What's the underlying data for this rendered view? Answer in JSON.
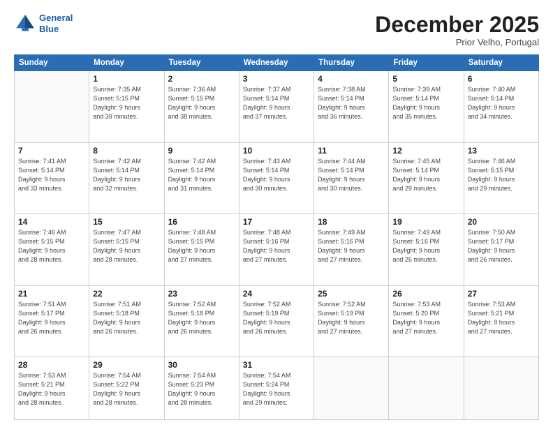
{
  "logo": {
    "line1": "General",
    "line2": "Blue"
  },
  "header": {
    "month": "December 2025",
    "location": "Prior Velho, Portugal"
  },
  "days_of_week": [
    "Sunday",
    "Monday",
    "Tuesday",
    "Wednesday",
    "Thursday",
    "Friday",
    "Saturday"
  ],
  "weeks": [
    [
      {
        "day": "",
        "info": ""
      },
      {
        "day": "1",
        "info": "Sunrise: 7:35 AM\nSunset: 5:15 PM\nDaylight: 9 hours\nand 39 minutes."
      },
      {
        "day": "2",
        "info": "Sunrise: 7:36 AM\nSunset: 5:15 PM\nDaylight: 9 hours\nand 38 minutes."
      },
      {
        "day": "3",
        "info": "Sunrise: 7:37 AM\nSunset: 5:14 PM\nDaylight: 9 hours\nand 37 minutes."
      },
      {
        "day": "4",
        "info": "Sunrise: 7:38 AM\nSunset: 5:14 PM\nDaylight: 9 hours\nand 36 minutes."
      },
      {
        "day": "5",
        "info": "Sunrise: 7:39 AM\nSunset: 5:14 PM\nDaylight: 9 hours\nand 35 minutes."
      },
      {
        "day": "6",
        "info": "Sunrise: 7:40 AM\nSunset: 5:14 PM\nDaylight: 9 hours\nand 34 minutes."
      }
    ],
    [
      {
        "day": "7",
        "info": "Sunrise: 7:41 AM\nSunset: 5:14 PM\nDaylight: 9 hours\nand 33 minutes."
      },
      {
        "day": "8",
        "info": "Sunrise: 7:42 AM\nSunset: 5:14 PM\nDaylight: 9 hours\nand 32 minutes."
      },
      {
        "day": "9",
        "info": "Sunrise: 7:42 AM\nSunset: 5:14 PM\nDaylight: 9 hours\nand 31 minutes."
      },
      {
        "day": "10",
        "info": "Sunrise: 7:43 AM\nSunset: 5:14 PM\nDaylight: 9 hours\nand 30 minutes."
      },
      {
        "day": "11",
        "info": "Sunrise: 7:44 AM\nSunset: 5:14 PM\nDaylight: 9 hours\nand 30 minutes."
      },
      {
        "day": "12",
        "info": "Sunrise: 7:45 AM\nSunset: 5:14 PM\nDaylight: 9 hours\nand 29 minutes."
      },
      {
        "day": "13",
        "info": "Sunrise: 7:46 AM\nSunset: 5:15 PM\nDaylight: 9 hours\nand 29 minutes."
      }
    ],
    [
      {
        "day": "14",
        "info": "Sunrise: 7:46 AM\nSunset: 5:15 PM\nDaylight: 9 hours\nand 28 minutes."
      },
      {
        "day": "15",
        "info": "Sunrise: 7:47 AM\nSunset: 5:15 PM\nDaylight: 9 hours\nand 28 minutes."
      },
      {
        "day": "16",
        "info": "Sunrise: 7:48 AM\nSunset: 5:15 PM\nDaylight: 9 hours\nand 27 minutes."
      },
      {
        "day": "17",
        "info": "Sunrise: 7:48 AM\nSunset: 5:16 PM\nDaylight: 9 hours\nand 27 minutes."
      },
      {
        "day": "18",
        "info": "Sunrise: 7:49 AM\nSunset: 5:16 PM\nDaylight: 9 hours\nand 27 minutes."
      },
      {
        "day": "19",
        "info": "Sunrise: 7:49 AM\nSunset: 5:16 PM\nDaylight: 9 hours\nand 26 minutes."
      },
      {
        "day": "20",
        "info": "Sunrise: 7:50 AM\nSunset: 5:17 PM\nDaylight: 9 hours\nand 26 minutes."
      }
    ],
    [
      {
        "day": "21",
        "info": "Sunrise: 7:51 AM\nSunset: 5:17 PM\nDaylight: 9 hours\nand 26 minutes."
      },
      {
        "day": "22",
        "info": "Sunrise: 7:51 AM\nSunset: 5:18 PM\nDaylight: 9 hours\nand 26 minutes."
      },
      {
        "day": "23",
        "info": "Sunrise: 7:52 AM\nSunset: 5:18 PM\nDaylight: 9 hours\nand 26 minutes."
      },
      {
        "day": "24",
        "info": "Sunrise: 7:52 AM\nSunset: 5:19 PM\nDaylight: 9 hours\nand 26 minutes."
      },
      {
        "day": "25",
        "info": "Sunrise: 7:52 AM\nSunset: 5:19 PM\nDaylight: 9 hours\nand 27 minutes."
      },
      {
        "day": "26",
        "info": "Sunrise: 7:53 AM\nSunset: 5:20 PM\nDaylight: 9 hours\nand 27 minutes."
      },
      {
        "day": "27",
        "info": "Sunrise: 7:53 AM\nSunset: 5:21 PM\nDaylight: 9 hours\nand 27 minutes."
      }
    ],
    [
      {
        "day": "28",
        "info": "Sunrise: 7:53 AM\nSunset: 5:21 PM\nDaylight: 9 hours\nand 28 minutes."
      },
      {
        "day": "29",
        "info": "Sunrise: 7:54 AM\nSunset: 5:22 PM\nDaylight: 9 hours\nand 28 minutes."
      },
      {
        "day": "30",
        "info": "Sunrise: 7:54 AM\nSunset: 5:23 PM\nDaylight: 9 hours\nand 28 minutes."
      },
      {
        "day": "31",
        "info": "Sunrise: 7:54 AM\nSunset: 5:24 PM\nDaylight: 9 hours\nand 29 minutes."
      },
      {
        "day": "",
        "info": ""
      },
      {
        "day": "",
        "info": ""
      },
      {
        "day": "",
        "info": ""
      }
    ]
  ]
}
